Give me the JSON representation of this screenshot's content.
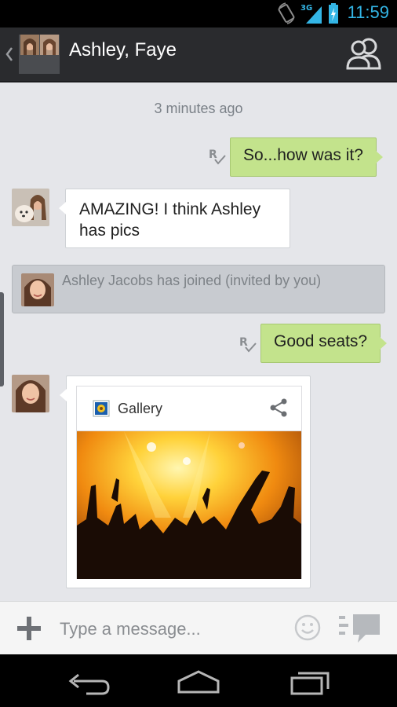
{
  "status_bar": {
    "time": "11:59",
    "network": "3G",
    "accent": "#33b5e5"
  },
  "action_bar": {
    "title": "Ashley, Faye",
    "icons": [
      "back-chevron-icon",
      "group-avatar",
      "people-icon"
    ]
  },
  "conversation": {
    "timestamp": "3 minutes ago",
    "messages": [
      {
        "direction": "outgoing",
        "text": "So...how was it?",
        "receipt": "read-receipt-icon"
      },
      {
        "direction": "incoming",
        "line1": "AMAZING! I think Ashley",
        "line2": "has pics"
      },
      {
        "type": "system",
        "text": "Ashley Jacobs has joined (invited by you)"
      },
      {
        "direction": "outgoing",
        "text": "Good seats?",
        "receipt": "read-receipt-icon"
      },
      {
        "direction": "incoming",
        "type": "attachment",
        "source_label": "Gallery",
        "icons": [
          "gallery-icon",
          "share-icon"
        ]
      }
    ],
    "colors": {
      "outgoing_bubble": "#c3e38c",
      "incoming_bubble": "#ffffff",
      "background": "#e5e6ea"
    }
  },
  "composer": {
    "placeholder": "Type a message...",
    "icons": [
      "plus-icon",
      "emoji-icon",
      "send-icon"
    ]
  },
  "nav_bar": {
    "buttons": [
      "back-icon",
      "home-icon",
      "recent-apps-icon"
    ]
  }
}
